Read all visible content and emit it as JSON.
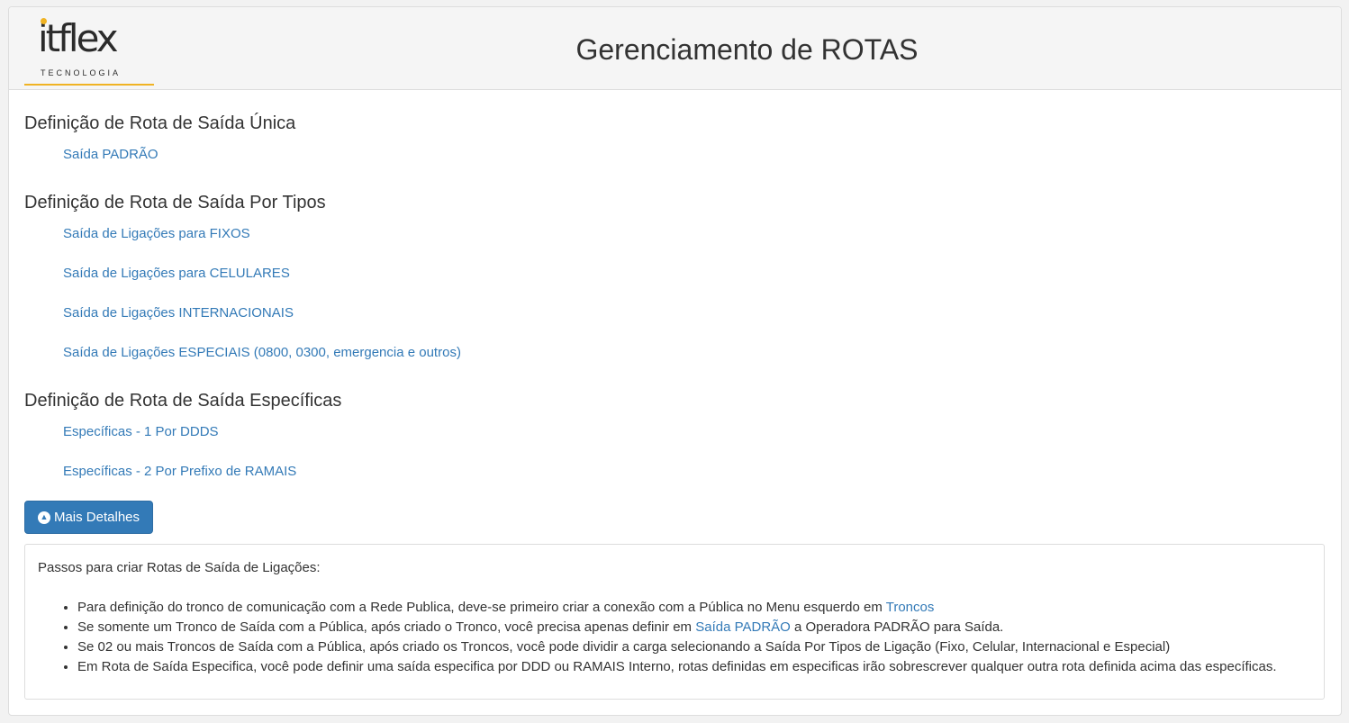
{
  "header": {
    "logo_text": "itflex",
    "logo_subtitle": "TECNOLOGIA",
    "title": "Gerenciamento de ROTAS"
  },
  "sections": [
    {
      "title": "Definição de Rota de Saída Única",
      "links": [
        "Saída PADRÃO"
      ]
    },
    {
      "title": "Definição de Rota de Saída Por Tipos",
      "links": [
        "Saída de Ligações para FIXOS",
        "Saída de Ligações para CELULARES",
        "Saída de Ligações INTERNACIONAIS",
        "Saída de Ligações ESPECIAIS (0800, 0300, emergencia e outros)"
      ]
    },
    {
      "title": "Definição de Rota de Saída Específicas",
      "links": [
        "Específicas - 1 Por DDDS",
        "Específicas - 2 Por Prefixo de RAMAIS"
      ]
    }
  ],
  "details_button": {
    "label": "Mais Detalhes",
    "icon": "chevron-circle-up-icon"
  },
  "details": {
    "intro": "Passos para criar Rotas de Saída de Ligações:",
    "items": [
      {
        "before": "Para definição do tronco de comunicação com a Rede Publica, deve-se primeiro criar a conexão com a Pública no Menu esquerdo em ",
        "link": "Troncos",
        "after": ""
      },
      {
        "before": "Se somente um Tronco de Saída com a Pública, após criado o Tronco, você precisa apenas definir em ",
        "link": "Saída PADRÃO",
        "after": " a Operadora PADRÃO para Saída."
      },
      {
        "before": "Se 02 ou mais Troncos de Saída com a Pública, após criado os Troncos, você pode dividir a carga selecionando a Saída Por Tipos de Ligação (Fixo, Celular, Internacional e Especial)",
        "link": "",
        "after": ""
      },
      {
        "before": "Em Rota de Saída Especifica, você pode definir uma saída especifica por DDD ou RAMAIS Interno, rotas definidas em especificas irão sobrescrever qualquer outra rota definida acima das específicas.",
        "link": "",
        "after": ""
      }
    ]
  },
  "colors": {
    "link": "#337ab7",
    "button": "#337ab7",
    "logo_accent": "#f0b323"
  }
}
